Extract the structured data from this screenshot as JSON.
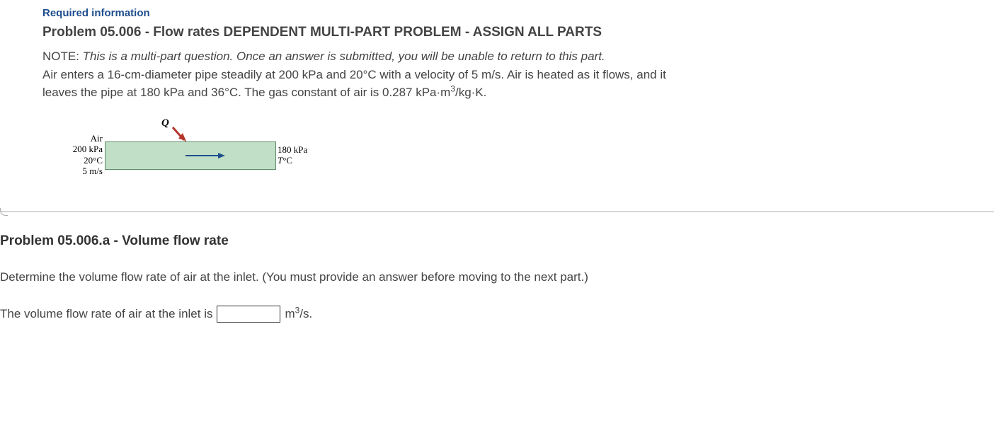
{
  "required_label": "Required information",
  "problem_title": "Problem 05.006 - Flow rates DEPENDENT MULTI-PART PROBLEM - ASSIGN ALL PARTS",
  "note_prefix": "NOTE: ",
  "note_italic": "This is a multi-part question. Once an answer is submitted, you will be unable to return to this part.",
  "body_line1": "Air enters a 16-cm-diameter pipe steadily at 200 kPa and 20°C with a velocity of 5 m/s. Air is heated as it flows, and it",
  "body_line2_pre": "leaves the pipe at 180 kPa and 36°C. The gas constant of air is 0.287 kPa·m",
  "body_line2_sup": "3",
  "body_line2_post": "/kg·K.",
  "diagram": {
    "q_label": "Q",
    "inlet": {
      "l1": "Air",
      "l2": "200 kPa",
      "l3": "20°C",
      "l4": "5 m/s"
    },
    "outlet": {
      "l1": "180 kPa",
      "l2_pre": "T",
      "l2_post": "°C"
    }
  },
  "sub_title": "Problem 05.006.a - Volume flow rate",
  "question_text": "Determine the volume flow rate of air at the inlet. (You must provide an answer before moving to the next part.)",
  "answer_label": "The volume flow rate of air at the inlet is",
  "answer_value": "",
  "answer_unit_pre": "m",
  "answer_unit_sup": "3",
  "answer_unit_post": "/s."
}
